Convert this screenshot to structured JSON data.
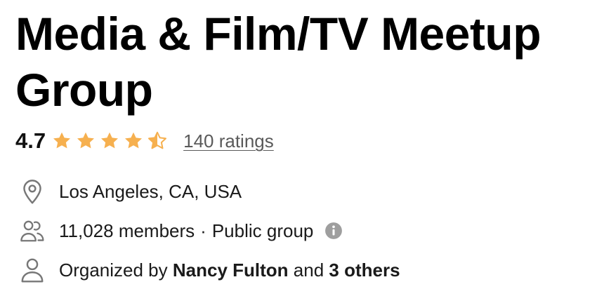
{
  "group": {
    "title": "Media & Film/TV Meetup Group",
    "rating": "4.7",
    "rating_value": 4.7,
    "rating_max": 5,
    "ratings_link": "140 ratings",
    "location": "Los Angeles, CA, USA",
    "members": "11,028 members",
    "separator": "·",
    "visibility": "Public group",
    "organized_by_prefix": "Organized by",
    "organizer_name": "Nancy Fulton",
    "and_text": "and",
    "others_text": "3 others"
  },
  "icons": {
    "location": "map-pin-icon",
    "members": "members-icon",
    "info": "info-icon",
    "organizer": "person-icon",
    "star": "star-icon"
  },
  "colors": {
    "star": "#F6B04F",
    "text": "#1a1a1a",
    "link": "#5a5a5a",
    "icon": "#777777",
    "info_badge": "#9e9e9e"
  }
}
